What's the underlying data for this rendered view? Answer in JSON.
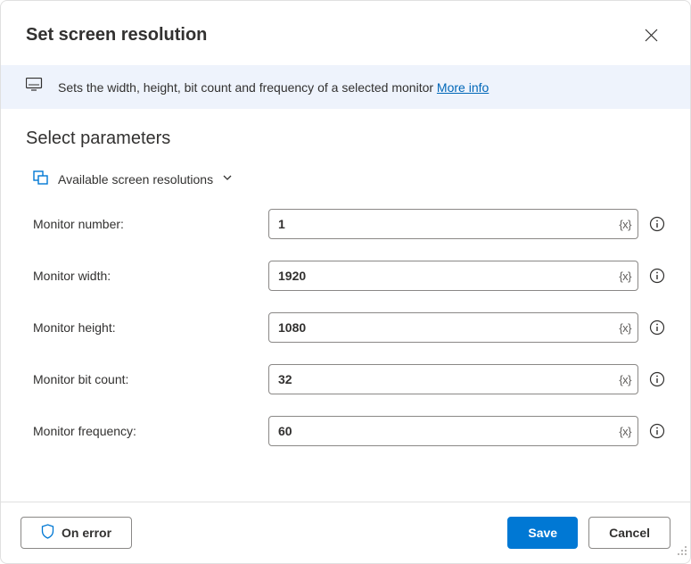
{
  "header": {
    "title": "Set screen resolution"
  },
  "banner": {
    "text": "Sets the width, height, bit count and frequency of a selected monitor ",
    "link": "More info"
  },
  "section": {
    "title": "Select parameters",
    "dropdown_label": "Available screen resolutions"
  },
  "params": {
    "monitor_number": {
      "label": "Monitor number:",
      "value": "1"
    },
    "monitor_width": {
      "label": "Monitor width:",
      "value": "1920"
    },
    "monitor_height": {
      "label": "Monitor height:",
      "value": "1080"
    },
    "monitor_bit_count": {
      "label": "Monitor bit count:",
      "value": "32"
    },
    "monitor_frequency": {
      "label": "Monitor frequency:",
      "value": "60"
    }
  },
  "footer": {
    "on_error": "On error",
    "save": "Save",
    "cancel": "Cancel"
  }
}
